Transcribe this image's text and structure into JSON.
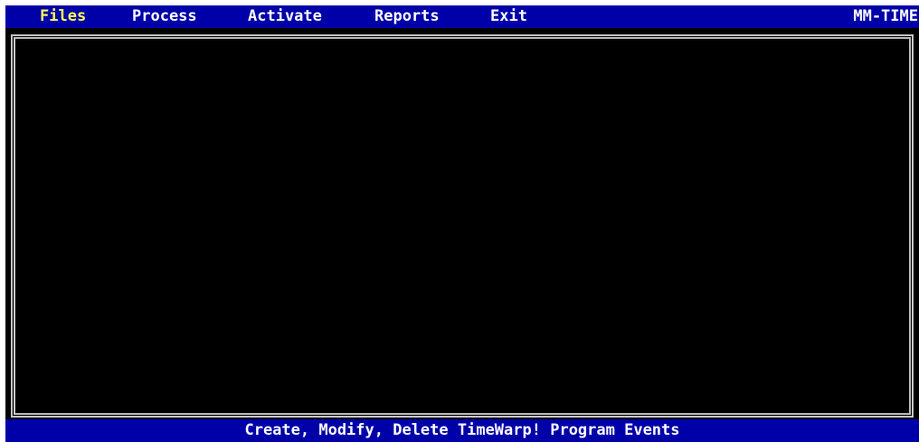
{
  "menubar": {
    "items": [
      {
        "label": "Files",
        "active": true
      },
      {
        "label": "Process",
        "active": false
      },
      {
        "label": "Activate",
        "active": false
      },
      {
        "label": "Reports",
        "active": false
      },
      {
        "label": "Exit",
        "active": false
      }
    ],
    "app_name": "MM-TIME"
  },
  "status": {
    "message": "Create, Modify, Delete TimeWarp! Program Events"
  },
  "colors": {
    "bar_background": "#0000a8",
    "bar_text": "#ffffff",
    "active_menu_text": "#ffff55",
    "screen_background": "#000000",
    "frame_border": "#c0c0c0"
  }
}
